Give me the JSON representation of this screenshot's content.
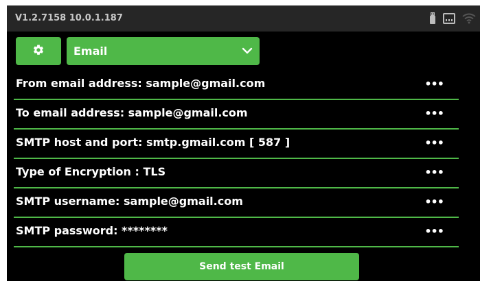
{
  "status_bar": {
    "version": "V1.2.7158",
    "ip": "10.0.1.187",
    "icons": [
      "usb-icon",
      "ethernet-icon",
      "wifi-icon"
    ]
  },
  "toolbar": {
    "settings_icon": "gear-icon",
    "selected_option": "Email",
    "dropdown_icon": "chevron-down-icon"
  },
  "settings": {
    "rows": [
      {
        "label": "From email address: sample@gmail.com",
        "more": "•••"
      },
      {
        "label": "To email address: sample@gmail.com",
        "more": "•••"
      },
      {
        "label": "SMTP host and port: smtp.gmail.com [ 587 ]",
        "more": "•••"
      },
      {
        "label": "Type of Encryption : TLS",
        "more": "•••"
      },
      {
        "label": "SMTP username: sample@gmail.com",
        "more": "•••"
      },
      {
        "label": "SMTP password: ********",
        "more": "•••"
      }
    ]
  },
  "actions": {
    "send_test_label": "Send test Email"
  },
  "colors": {
    "accent": "#4fb848",
    "background": "#000000",
    "status_bar": "#262626"
  }
}
